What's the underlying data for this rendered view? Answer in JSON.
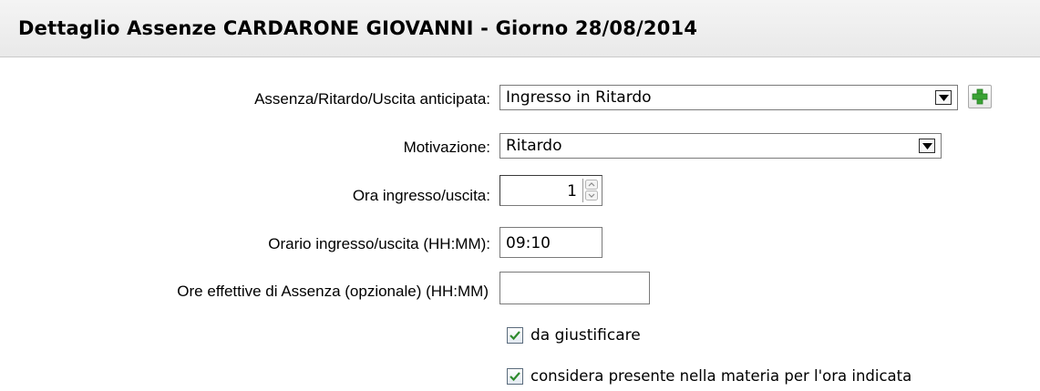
{
  "header": {
    "title": "Dettaglio Assenze CARDARONE GIOVANNI - Giorno 28/08/2014"
  },
  "form": {
    "tipo": {
      "label": "Assenza/Ritardo/Uscita anticipata:",
      "value": "Ingresso in Ritardo",
      "icon": "chevron-down-icon"
    },
    "add_button": {
      "icon": "plus-icon",
      "color": "#3aa335"
    },
    "motivazione": {
      "label": "Motivazione:",
      "value": "Ritardo",
      "icon": "chevron-down-icon"
    },
    "ora": {
      "label": "Ora ingresso/uscita:",
      "value": "1"
    },
    "orario": {
      "label": "Orario ingresso/uscita (HH:MM):",
      "value": "09:10"
    },
    "ore_effettive": {
      "label": "Ore effettive di Assenza (opzionale) (HH:MM)",
      "value": ""
    },
    "da_giustificare": {
      "label": "da giustificare",
      "checked": true
    },
    "considera_presente": {
      "label": "considera presente nella materia per l'ora indicata",
      "checked": true
    }
  },
  "colors": {
    "header_bg": "#ececec",
    "checkmark": "#2d8a2d"
  }
}
